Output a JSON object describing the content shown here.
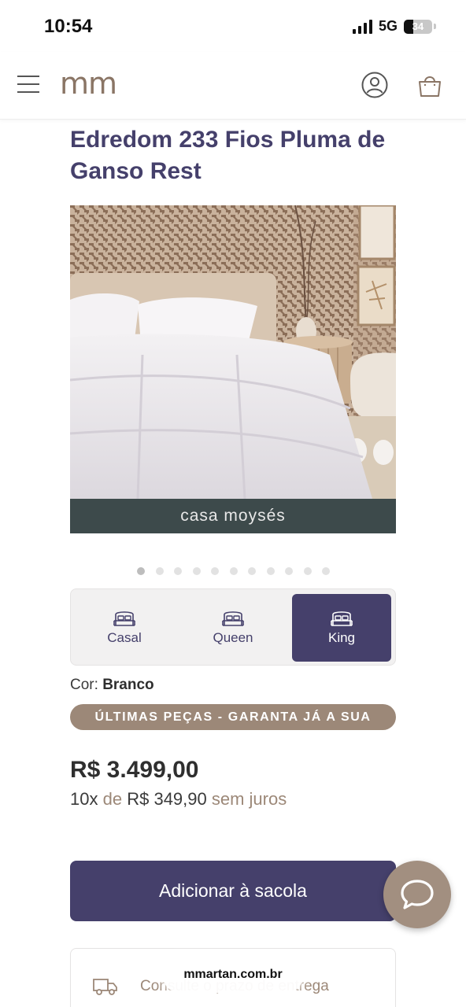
{
  "status_bar": {
    "time": "10:54",
    "network": "5G",
    "battery": "34",
    "battery_level": 0.34
  },
  "header": {
    "logo": "mm",
    "icons": [
      "menu-icon",
      "user-icon",
      "shopping-bag-icon"
    ]
  },
  "product": {
    "title": "Edredom 233 Fios Pluma de Ganso Rest",
    "image_brand": "casa moysés",
    "image_count": 11,
    "active_image": 1
  },
  "sizes": {
    "options": [
      {
        "label": "Casal",
        "icon": "bed-icon"
      },
      {
        "label": "Queen",
        "icon": "bed-icon"
      },
      {
        "label": "King",
        "icon": "bed-icon"
      }
    ],
    "selected": "King"
  },
  "color": {
    "label": "Cor:",
    "value": "Branco"
  },
  "stock_badge": "ÚLTIMAS PEÇAS - GARANTA JÁ A SUA",
  "pricing": {
    "price": "R$ 3.499,00",
    "installments_count": "10x",
    "installments_of": "de",
    "installment_value": "R$ 349,90",
    "installments_suffix": "sem juros"
  },
  "add_to_bag": "Adicionar à sacola",
  "shipping": {
    "label": "Consulte o prazo de entrega"
  },
  "browser": {
    "url": "mmartan.com.br"
  },
  "colors": {
    "primary": "#45406b",
    "accent": "#9c8878",
    "brand_band": "#3d4a4b"
  }
}
